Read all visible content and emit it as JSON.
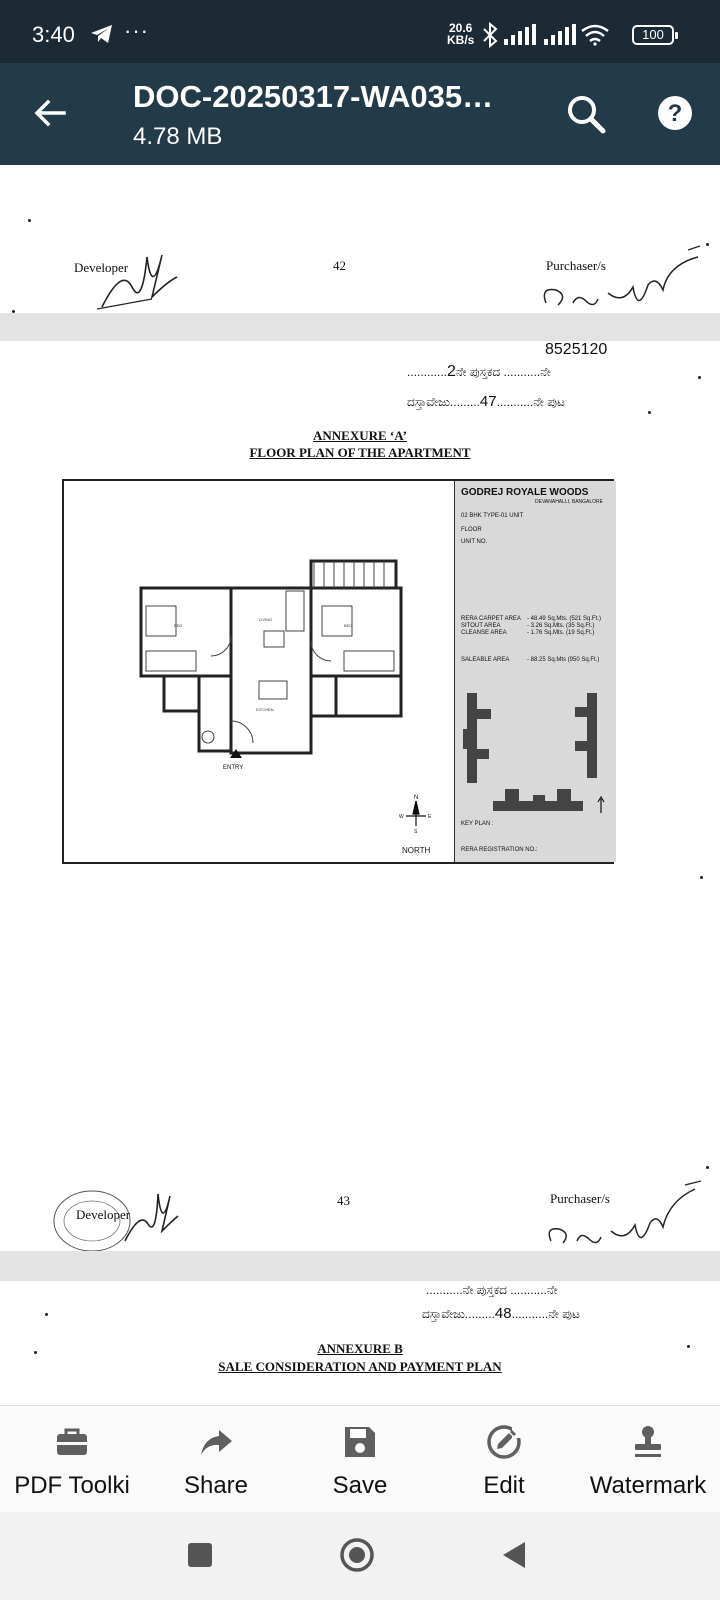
{
  "status_bar": {
    "time": "3:40",
    "overflow": "···",
    "net_speed_value": "20.6",
    "net_speed_unit": "KB/s",
    "battery": "100",
    "icons": [
      "telegram-icon",
      "bluetooth-icon",
      "signal-icon",
      "signal-icon",
      "wifi-icon",
      "battery-icon"
    ]
  },
  "app_bar": {
    "title": "DOC-20250317-WA035…",
    "subtitle": "4.78 MB",
    "back_icon": "arrow-left-icon",
    "search_icon": "search-icon",
    "help_icon": "help-icon"
  },
  "document": {
    "page42": {
      "developer": "Developer",
      "page_number": "42",
      "purchaser": "Purchaser/s"
    },
    "page43": {
      "stamp_line1": "2",
      "stamp_line1_suffix": "ನೇ ಪುಸ್ತಕದ ...........ನೇ",
      "stamp_line2_prefix": "ದಸ್ತಾವೇಜು.........",
      "stamp_line2_value": "47",
      "stamp_line2_suffix": "...........ನೇ ಪುಟ",
      "stamp_number": "8525120",
      "annexure": "ANNEXURE ‘A’",
      "heading": "FLOOR PLAN OF THE APARTMENT",
      "plan": {
        "project": "GODREJ ROYALE WOODS",
        "location": "DEVANAHALLI, BANGALORE",
        "unit_type": "02 BHK TYPE-01 UNIT",
        "floor": "FLOOR",
        "unit_no": "UNIT NO.",
        "areas": [
          "RERA CARPET AREA",
          "SITOUT AREA",
          "CLEANSE AREA"
        ],
        "area_values": [
          "- 48.49 Sq.Mts. (521 Sq.Ft.)",
          "- 3.26 Sq.Mts. (35 Sq.Ft.)",
          "- 1.76 Sq.Mts. (19 Sq.Ft.)"
        ],
        "saleable": "SALEABLE AREA",
        "saleable_value": "- 88.25 Sq.Mts (950 Sq.Ft.)",
        "key_plan": "KEY PLAN :",
        "rera": "RERA REGISTRATION NO.:",
        "entry": "ENTRY",
        "north": "NORTH",
        "compass_n": "N",
        "compass_e": "E",
        "compass_w": "W",
        "compass_s": "S"
      },
      "developer": "Developer",
      "page_number": "43",
      "purchaser": "Purchaser/s"
    },
    "page44": {
      "stamp_line1": "...........ನೇ ಪುಸ್ತಕದ ...........ನೇ",
      "stamp_line2_prefix": "ದಸ್ತಾವೇಜು.........",
      "stamp_line2_value": "48",
      "stamp_line2_suffix": "...........ನೇ ಪುಟ",
      "annexure": "ANNEXURE B",
      "heading": "SALE CONSIDERATION AND PAYMENT PLAN"
    }
  },
  "toolbar": [
    {
      "label": "PDF Toolki",
      "icon": "toolbox-icon"
    },
    {
      "label": "Share",
      "icon": "share-icon"
    },
    {
      "label": "Save",
      "icon": "save-icon"
    },
    {
      "label": "Edit",
      "icon": "edit-icon"
    },
    {
      "label": "Watermark",
      "icon": "watermark-icon"
    }
  ],
  "nav_bar": {
    "icons": [
      "recents-icon",
      "home-icon",
      "back-icon"
    ]
  },
  "colors": {
    "status_bar": "#1c2a35",
    "app_bar": "#233a48",
    "page_separator": "#e3e3e3",
    "toolbar_bg": "#fafafa",
    "nav_bar_bg": "#f2f2f2"
  }
}
